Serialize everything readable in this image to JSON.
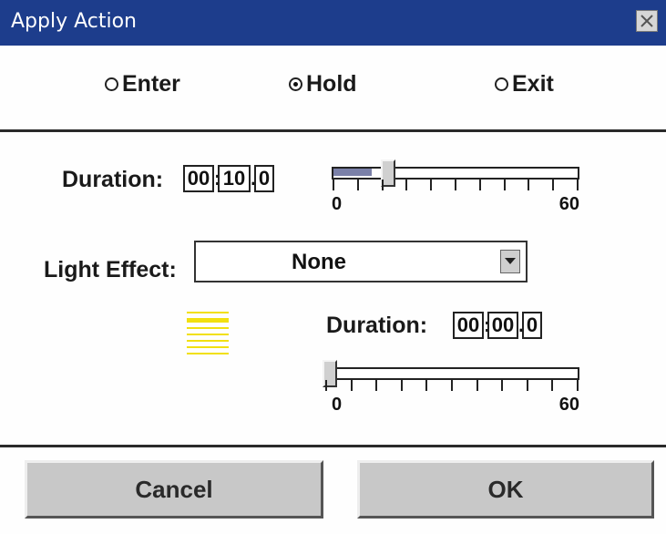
{
  "window": {
    "title": "Apply Action"
  },
  "mode": {
    "options": [
      {
        "label": "Enter",
        "selected": false
      },
      {
        "label": "Hold",
        "selected": true
      },
      {
        "label": "Exit",
        "selected": false
      }
    ]
  },
  "duration": {
    "label": "Duration:",
    "minutes": "00",
    "seconds": "10",
    "tenths": "0",
    "slider": {
      "min_label": "0",
      "max_label": "60",
      "min": 0,
      "max": 60,
      "value": 10
    }
  },
  "light_effect": {
    "label": "Light Effect:",
    "selected": "None"
  },
  "light_duration": {
    "label": "Duration:",
    "minutes": "00",
    "seconds": "00",
    "tenths": "0",
    "slider": {
      "min_label": "0",
      "max_label": "60",
      "min": 0,
      "max": 60,
      "value": 0
    }
  },
  "buttons": {
    "cancel": "Cancel",
    "ok": "OK"
  },
  "colors": {
    "titlebar": "#1d3d8c",
    "light_icon": "#f2e010",
    "slider_fill": "#7a80a8"
  },
  "icons": {
    "close": "close-icon",
    "dropdown": "chevron-down-icon",
    "light": "light-effect-icon"
  }
}
